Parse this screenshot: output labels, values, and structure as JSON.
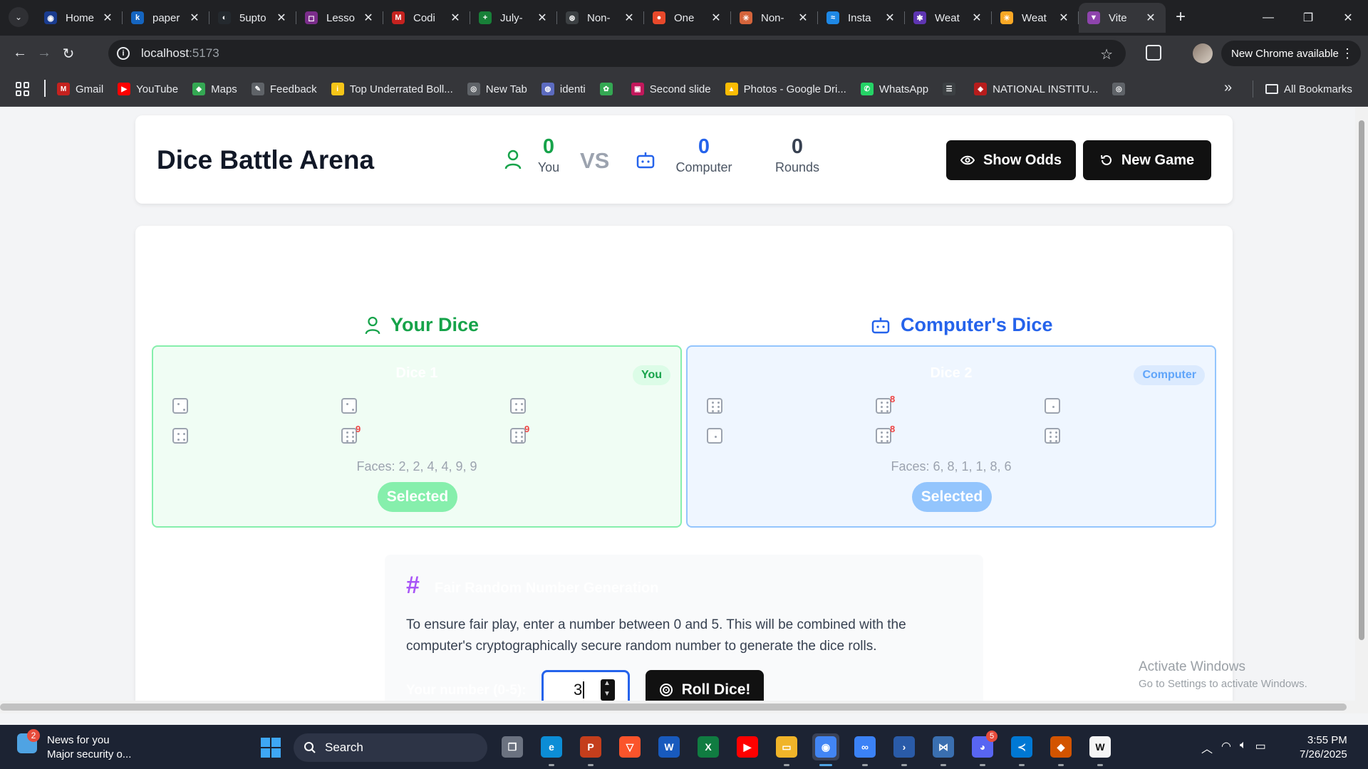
{
  "browser": {
    "tabs": [
      {
        "title": "Home",
        "color": "#1a3c8f",
        "glyph": "◉"
      },
      {
        "title": "paper",
        "color": "#1565c0",
        "glyph": "k"
      },
      {
        "title": "5upto",
        "color": "#24292e",
        "glyph": "◐"
      },
      {
        "title": "Lesso",
        "color": "#7b2d8b",
        "glyph": "◻"
      },
      {
        "title": "Codi",
        "color": "#c5221f",
        "glyph": "M"
      },
      {
        "title": "July-",
        "color": "#188038",
        "glyph": "+"
      },
      {
        "title": "Non-",
        "color": "#3c4043",
        "glyph": "⊛"
      },
      {
        "title": "One",
        "color": "#e8492b",
        "glyph": "●"
      },
      {
        "title": "Non-",
        "color": "#d4643b",
        "glyph": "✳"
      },
      {
        "title": "Insta",
        "color": "#1e88e5",
        "glyph": "≈"
      },
      {
        "title": "Weat",
        "color": "#5e35b1",
        "glyph": "✱"
      },
      {
        "title": "Weat",
        "color": "#f9a825",
        "glyph": "☀"
      },
      {
        "title": "Vite",
        "color": "#8e44ad",
        "glyph": "▼"
      }
    ],
    "active_tab": 12,
    "url_host": "localhost",
    "url_port": ":5173",
    "update_chip": "New Chrome available",
    "bookmarks": [
      {
        "label": "Gmail",
        "color": "#c5221f",
        "glyph": "M"
      },
      {
        "label": "YouTube",
        "color": "#ff0000",
        "glyph": "▶"
      },
      {
        "label": "Maps",
        "color": "#34a853",
        "glyph": "◆"
      },
      {
        "label": "Feedback",
        "color": "#5f6368",
        "glyph": "✎"
      },
      {
        "label": "Top Underrated Boll...",
        "color": "#f5c518",
        "glyph": "i"
      },
      {
        "label": "New Tab",
        "color": "#5f6368",
        "glyph": "◎"
      },
      {
        "label": "identi",
        "color": "#5c6bc0",
        "glyph": "◍"
      },
      {
        "label": "",
        "color": "#34a853",
        "glyph": "✿"
      },
      {
        "label": "Second slide",
        "color": "#c2185b",
        "glyph": "▣"
      },
      {
        "label": "Photos - Google Dri...",
        "color": "#fbbc04",
        "glyph": "▲"
      },
      {
        "label": "WhatsApp",
        "color": "#25d366",
        "glyph": "✆"
      },
      {
        "label": "",
        "color": "#3c4043",
        "glyph": "☰"
      },
      {
        "label": "NATIONAL INSTITU...",
        "color": "#b71c1c",
        "glyph": "◈"
      },
      {
        "label": "",
        "color": "#5f6368",
        "glyph": "◎"
      }
    ],
    "all_bookmarks": "All Bookmarks"
  },
  "app": {
    "title": "Dice Battle Arena",
    "score": {
      "you_value": "0",
      "you_label": "You",
      "vs": "VS",
      "computer_value": "0",
      "computer_label": "Computer",
      "rounds_value": "0",
      "rounds_label": "Rounds"
    },
    "show_odds": "Show Odds",
    "new_game": "New Game",
    "your_dice_heading": "Your Dice",
    "computer_dice_heading": "Computer's Dice",
    "player_panel": {
      "title": "Dice 1",
      "badge": "You",
      "faces": [
        2,
        2,
        4,
        4,
        9,
        9
      ],
      "faces_text": "Faces: 2, 2, 4, 4, 9, 9",
      "status": "Selected"
    },
    "computer_panel": {
      "title": "Dice 2",
      "badge": "Computer",
      "faces": [
        6,
        8,
        1,
        1,
        8,
        6
      ],
      "faces_text": "Faces: 6, 8, 1, 1, 8, 6",
      "status": "Selected"
    },
    "rng": {
      "title": "Fair Random Number Generation",
      "description": "To ensure fair play, enter a number between 0 and 5. This will be combined with the computer's cryptographically secure random number to generate the dice rolls.",
      "input_label": "Your number (0-5):",
      "input_value": "3",
      "roll_button": "Roll Dice!"
    },
    "colors": {
      "player": "#16a34a",
      "computer": "#2563eb"
    }
  },
  "watermark": {
    "line1": "Activate Windows",
    "line2": "Go to Settings to activate Windows."
  },
  "taskbar": {
    "news_title": "News for you",
    "news_subtitle": "Major security o...",
    "news_badge": "2",
    "search_label": "Search",
    "apps": [
      {
        "name": "task-view",
        "color": "#6b7280",
        "glyph": "❐"
      },
      {
        "name": "edge",
        "color": "#0c8dd6",
        "glyph": "e"
      },
      {
        "name": "powerpoint",
        "color": "#c43e1c",
        "glyph": "P"
      },
      {
        "name": "brave",
        "color": "#fb542b",
        "glyph": "▽"
      },
      {
        "name": "word",
        "color": "#185abd",
        "glyph": "W"
      },
      {
        "name": "excel",
        "color": "#107c41",
        "glyph": "X"
      },
      {
        "name": "youtube",
        "color": "#ff0000",
        "glyph": "▶"
      },
      {
        "name": "file-explorer",
        "color": "#f0b429",
        "glyph": "▭"
      },
      {
        "name": "chrome",
        "color": "#4285f4",
        "glyph": "◉"
      },
      {
        "name": "copilot",
        "color": "#3b82f6",
        "glyph": "∞"
      },
      {
        "name": "powershell",
        "color": "#2a5ba8",
        "glyph": "›"
      },
      {
        "name": "vs-community",
        "color": "#3a6fb0",
        "glyph": "⋈"
      },
      {
        "name": "discord",
        "color": "#5865f2",
        "glyph": "◕"
      },
      {
        "name": "vscode",
        "color": "#0078d4",
        "glyph": "≺"
      },
      {
        "name": "office",
        "color": "#d35400",
        "glyph": "◆"
      },
      {
        "name": "notion-like",
        "color": "#f5f5f5",
        "glyph": "W"
      }
    ],
    "discord_badge": "5",
    "time": "3:55 PM",
    "date": "7/26/2025"
  }
}
